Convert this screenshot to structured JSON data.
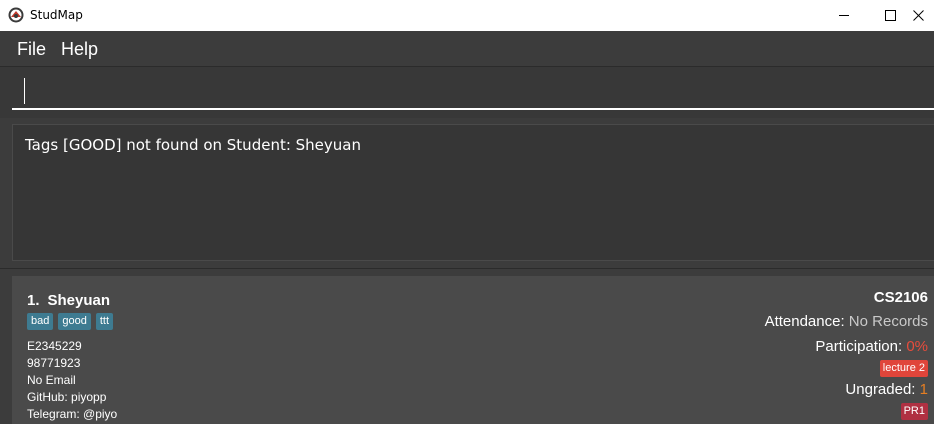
{
  "window": {
    "title": "StudMap",
    "icons": {
      "app": "studmap-logo-icon",
      "minimize": "minimize-icon",
      "maximize": "maximize-icon",
      "close": "close-icon"
    }
  },
  "menu": {
    "file": "File",
    "help": "Help"
  },
  "command": {
    "value": "",
    "placeholder": ""
  },
  "result": {
    "message": "Tags [GOOD] not found on Student: Sheyuan"
  },
  "students": [
    {
      "index": "1.",
      "name": "Sheyuan",
      "tags": [
        "bad",
        "good",
        "ttt"
      ],
      "student_id": "E2345229",
      "phone": "98771923",
      "email": "No Email",
      "github": "GitHub: piyopp",
      "telegram": "Telegram: @piyo",
      "module": "CS2106",
      "attendance_label": "Attendance:",
      "attendance_value": "No Records",
      "participation_label": "Participation:",
      "participation_value": "0%",
      "participation_tag": "lecture 2",
      "ungraded_label": "Ungraded:",
      "ungraded_value": "1",
      "ungraded_tag": "PR1"
    }
  ],
  "colors": {
    "background": "#3c3c3c",
    "card": "#4a4a4a",
    "tag": "#3e7b91",
    "participation_percent": "#e74c3c",
    "lecture_tag": "#e0453a",
    "ungraded_count": "#e67e22",
    "pr_tag": "#b03042"
  }
}
